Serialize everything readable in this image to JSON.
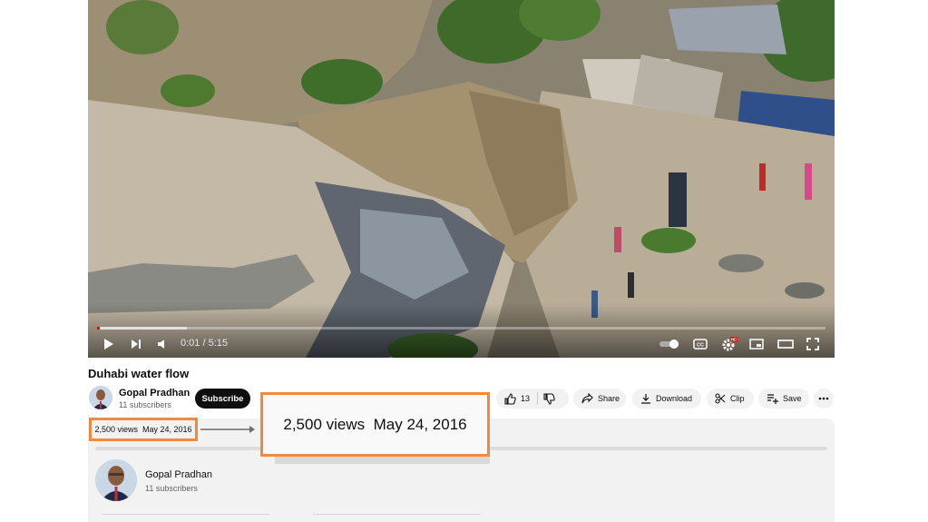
{
  "player": {
    "time_display": "0:01 / 5:15",
    "progress_fraction": 0.003,
    "settings_badge": "HD",
    "accent_color": "#ff0000"
  },
  "video": {
    "title": "Duhabi water flow"
  },
  "channel": {
    "name": "Gopal Pradhan",
    "subscribers": "11 subscribers",
    "subscribe_label": "Subscribe"
  },
  "actions": {
    "like_count": "13",
    "share_label": "Share",
    "download_label": "Download",
    "clip_label": "Clip",
    "save_label": "Save"
  },
  "info": {
    "views": "2,500 views",
    "date": "May 24, 2016"
  },
  "annotation": {
    "highlight_color": "#f28a3c"
  },
  "icons": [
    "play-icon",
    "next-icon",
    "volume-icon",
    "autoplay-toggle-icon",
    "captions-icon",
    "settings-icon",
    "miniplayer-icon",
    "theater-icon",
    "fullscreen-icon",
    "thumbs-up-icon",
    "thumbs-down-icon",
    "share-icon",
    "download-icon",
    "scissors-icon",
    "playlist-add-icon",
    "more-icon"
  ]
}
